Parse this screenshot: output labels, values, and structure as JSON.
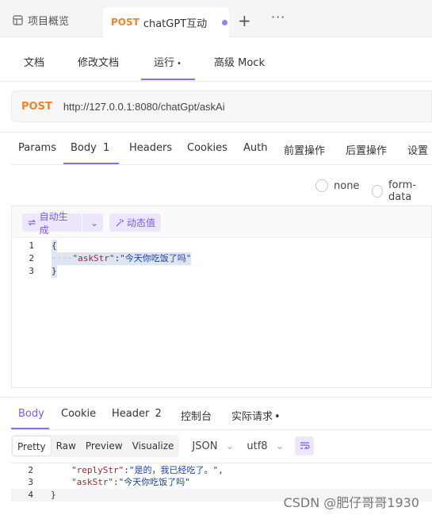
{
  "top_tabs": {
    "overview_label": "项目概览",
    "active_method": "POST",
    "active_title": "chatGPT互动",
    "add_symbol": "+",
    "more_symbol": "···"
  },
  "subnav": {
    "docs": "文档",
    "edit_docs": "修改文档",
    "run": "运行",
    "run_dot": "•",
    "advanced": "高级 Mock"
  },
  "request": {
    "method": "POST",
    "url": "http://127.0.0.1:8080/chatGpt/askAi"
  },
  "request_tabs": {
    "params": "Params",
    "body": "Body",
    "body_count": "1",
    "headers": "Headers",
    "cookies": "Cookies",
    "auth": "Auth",
    "pre_ops": "前置操作",
    "post_ops": "后置操作",
    "settings": "设置"
  },
  "body_types": {
    "none": "none",
    "form_data": "form-data"
  },
  "editor_toolbar": {
    "auto_generate": "自动生成",
    "dynamic_value": "动态值"
  },
  "request_body": {
    "lines": [
      {
        "num": "1",
        "text": "{"
      },
      {
        "num": "2",
        "indent": "····",
        "key": "\"askStr\"",
        "colon": ":",
        "value": "\"今天你吃饭了吗\""
      },
      {
        "num": "3",
        "text": "}"
      }
    ]
  },
  "response_tabs": {
    "body": "Body",
    "cookie": "Cookie",
    "header": "Header",
    "header_count": "2",
    "console": "控制台",
    "actual_request": "实际请求",
    "actual_dot": "•"
  },
  "response_format": {
    "pretty": "Pretty",
    "raw": "Raw",
    "preview": "Preview",
    "visualize": "Visualize",
    "lang": "JSON",
    "encoding": "utf8"
  },
  "response_body": {
    "lines": [
      {
        "num": "2",
        "key": "\"replyStr\"",
        "colon": ": ",
        "value": "\"是的，我已经吃了。\"",
        "comma": ","
      },
      {
        "num": "3",
        "key": "\"askStr\"",
        "colon": ": ",
        "value": "\"今天你吃饭了吗\"",
        "comma": ""
      },
      {
        "num": "4",
        "text": "}"
      }
    ]
  },
  "watermark": "CSDN @肥仔哥哥1930",
  "colors": {
    "accent": "#7a5af5",
    "post": "#f5822a",
    "badge_green": "#3aa860"
  }
}
